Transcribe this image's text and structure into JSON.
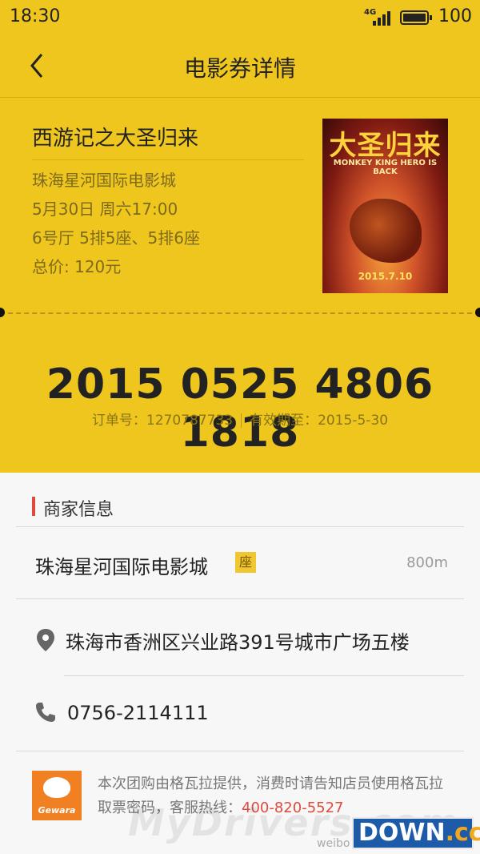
{
  "status_bar": {
    "time": "18:30",
    "network": "4G",
    "battery_pct": "100"
  },
  "nav": {
    "title": "电影券详情"
  },
  "ticket": {
    "movie": "西游记之大圣归来",
    "cinema": "珠海星河国际电影城",
    "showtime": "5月30日  周六17:00",
    "seats": "6号厅  5排5座、5排6座",
    "total": "总价: 120元"
  },
  "poster": {
    "title": "大圣归来",
    "subtitle": "MONKEY KING HERO IS BACK",
    "date": "2015.7.10"
  },
  "voucher": {
    "code": "2015 0525 4806 1818",
    "order_no": "订单号：1270787733",
    "valid_until": "有效期至：2015-5-30"
  },
  "merchant": {
    "section_title": "商家信息",
    "cinema_name": "珠海星河国际电影城",
    "seat_badge": "座",
    "distance": "800m",
    "address": "珠海市香洲区兴业路391号城市广场五楼",
    "phone": "0756-2114111"
  },
  "provider": {
    "brand": "Gewara",
    "note": "本次团购由格瓦拉提供，消费时请告知店员使用格瓦拉取票密码，客服热线：",
    "hotline": "400-820-5527"
  },
  "watermark": {
    "text": "MyDrivers.com",
    "source": "weibo",
    "logo_main": "DOWN",
    "logo_suffix": ".cc"
  },
  "colors": {
    "ticket_bg": "#eec61d",
    "accent_red": "#e04a3c",
    "provider_orange": "#f08021"
  }
}
